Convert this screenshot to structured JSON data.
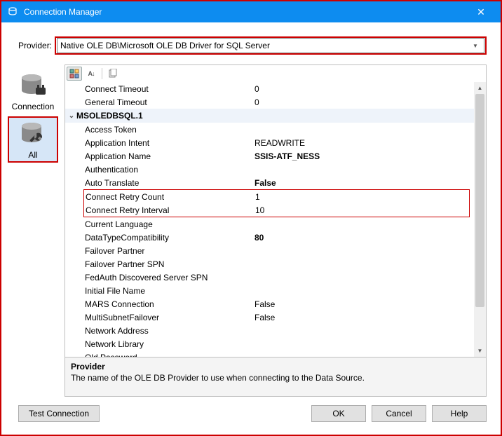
{
  "window": {
    "title": "Connection Manager",
    "close": "✕"
  },
  "provider": {
    "label": "Provider:",
    "value": "Native OLE DB\\Microsoft OLE DB Driver for SQL Server"
  },
  "side_tabs": {
    "connection": "Connection",
    "all": "All"
  },
  "toolbar": {
    "categorized_tip": "Categorized",
    "alpha_label": "A↓",
    "props_tip": "Property Pages"
  },
  "category": {
    "name": "MSOLEDBSQL.1"
  },
  "props": {
    "connect_timeout": {
      "name": "Connect Timeout",
      "value": "0"
    },
    "general_timeout": {
      "name": "General Timeout",
      "value": "0"
    },
    "access_token": {
      "name": "Access Token",
      "value": ""
    },
    "app_intent": {
      "name": "Application Intent",
      "value": "READWRITE"
    },
    "app_name": {
      "name": "Application Name",
      "value": "SSIS-ATF_NESS"
    },
    "auth": {
      "name": "Authentication",
      "value": ""
    },
    "auto_translate": {
      "name": "Auto Translate",
      "value": "False"
    },
    "retry_count": {
      "name": "Connect Retry Count",
      "value": "1"
    },
    "retry_interval": {
      "name": "Connect Retry Interval",
      "value": "10"
    },
    "cur_lang": {
      "name": "Current Language",
      "value": ""
    },
    "dtc": {
      "name": "DataTypeCompatibility",
      "value": "80"
    },
    "failover_partner": {
      "name": "Failover Partner",
      "value": ""
    },
    "failover_spn": {
      "name": "Failover Partner SPN",
      "value": ""
    },
    "fedauth_spn": {
      "name": "FedAuth Discovered Server SPN",
      "value": ""
    },
    "init_file": {
      "name": "Initial File Name",
      "value": ""
    },
    "mars": {
      "name": "MARS Connection",
      "value": "False"
    },
    "multisubnet": {
      "name": "MultiSubnetFailover",
      "value": "False"
    },
    "net_addr": {
      "name": "Network Address",
      "value": ""
    },
    "net_lib": {
      "name": "Network Library",
      "value": ""
    },
    "old_pwd": {
      "name": "Old Password",
      "value": ""
    }
  },
  "description": {
    "title": "Provider",
    "text": "The name of the OLE DB Provider to use when connecting to the Data Source."
  },
  "buttons": {
    "test": "Test Connection",
    "ok": "OK",
    "cancel": "Cancel",
    "help": "Help"
  }
}
